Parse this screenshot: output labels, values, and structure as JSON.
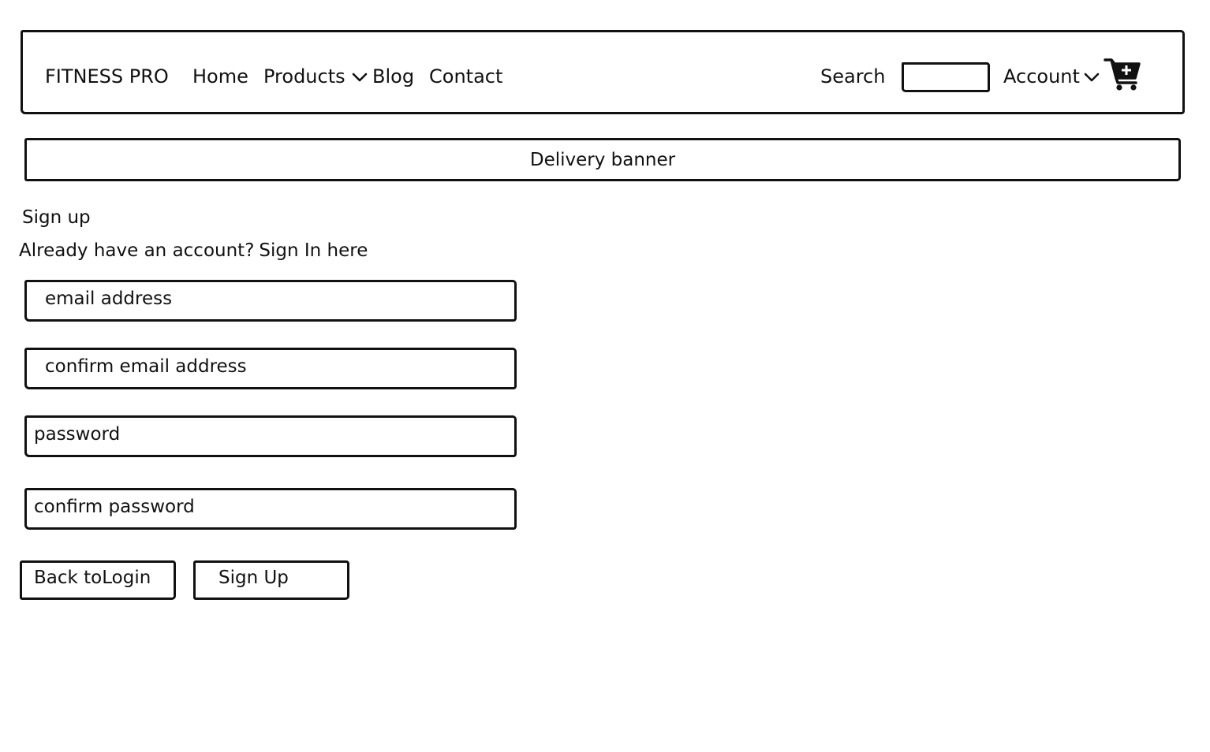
{
  "header": {
    "brand": "FITNESS PRO",
    "nav": {
      "home": "Home",
      "products": "Products",
      "blog": "Blog",
      "contact": "Contact"
    },
    "search_label": "Search",
    "account_label": "Account",
    "icons": {
      "products_dropdown": "chevron-down-icon",
      "account_dropdown": "chevron-down-icon",
      "cart": "cart-plus-icon"
    }
  },
  "banner": {
    "text": "Delivery banner"
  },
  "form": {
    "title": "Sign up",
    "signin_prefix": "Already have an account?",
    "signin_link": "Sign In here",
    "fields": {
      "email_placeholder": "email address",
      "email_confirm_placeholder": "confirm email address",
      "password_placeholder": "password",
      "password_confirm_placeholder": "confirm password"
    },
    "buttons": {
      "back": "Back toLogin",
      "signup": "Sign Up"
    }
  },
  "colors": {
    "ink": "#111111",
    "background": "#ffffff"
  }
}
